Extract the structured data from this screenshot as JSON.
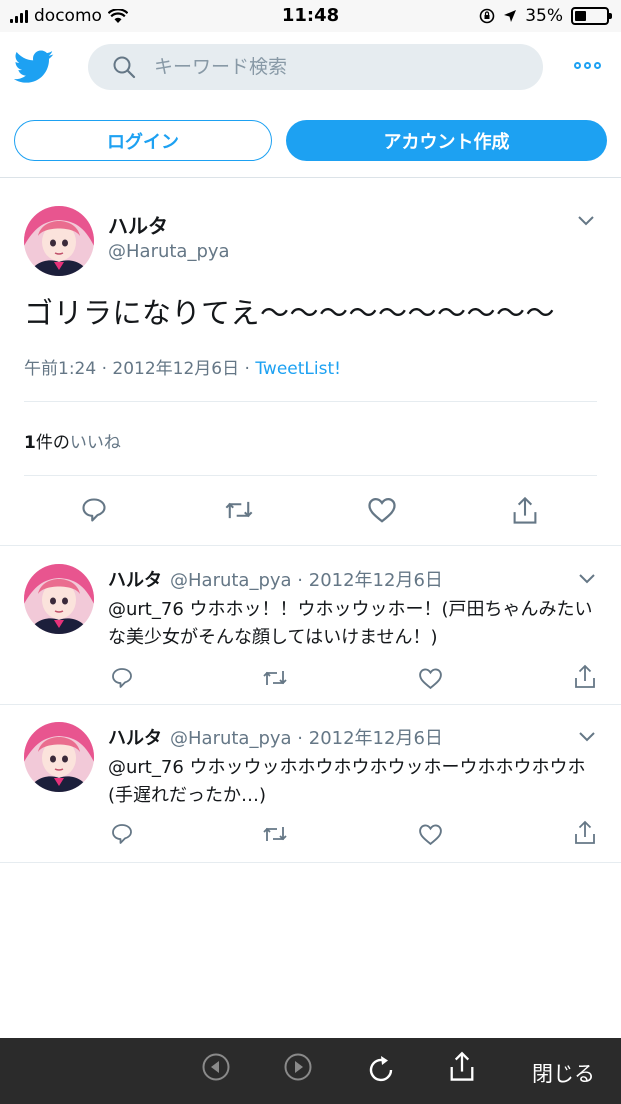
{
  "status_bar": {
    "carrier": "docomo",
    "time": "11:48",
    "battery": "35%",
    "battery_level": 0.35
  },
  "header": {
    "search_placeholder": "キーワード検索",
    "login_label": "ログイン",
    "signup_label": "アカウント作成"
  },
  "main_tweet": {
    "name": "ハルタ",
    "handle": "@Haruta_pya",
    "text": "ゴリラになりてえ〜〜〜〜〜〜〜〜〜〜",
    "time": "午前1:24",
    "date": "2012年12月6日",
    "source": "TweetList!",
    "likes_count": "1",
    "likes_unit": "件の",
    "likes_label": "いいね"
  },
  "replies": [
    {
      "name": "ハルタ",
      "handle": "@Haruta_pya",
      "date": "2012年12月6日",
      "text": "@urt_76 ウホホッ！！ウホッウッホー！(戸田ちゃんみたいな美少女がそんな顔してはいけません！)"
    },
    {
      "name": "ハルタ",
      "handle": "@Haruta_pya",
      "date": "2012年12月6日",
      "text": "@urt_76 ウホッウッホホウホウホウッホーウホホウホウホ(手遅れだったか…)"
    }
  ],
  "toolbar": {
    "close_label": "閉じる"
  },
  "colors": {
    "accent": "#1da1f2",
    "secondary_text": "#657786",
    "toolbar_bg": "#2b2b2b"
  },
  "icons": [
    "twitter-bird-icon",
    "search-icon",
    "more-icon",
    "chevron-down-icon",
    "reply-icon",
    "retweet-icon",
    "like-icon",
    "share-icon",
    "back-icon",
    "forward-icon",
    "reload-icon"
  ]
}
